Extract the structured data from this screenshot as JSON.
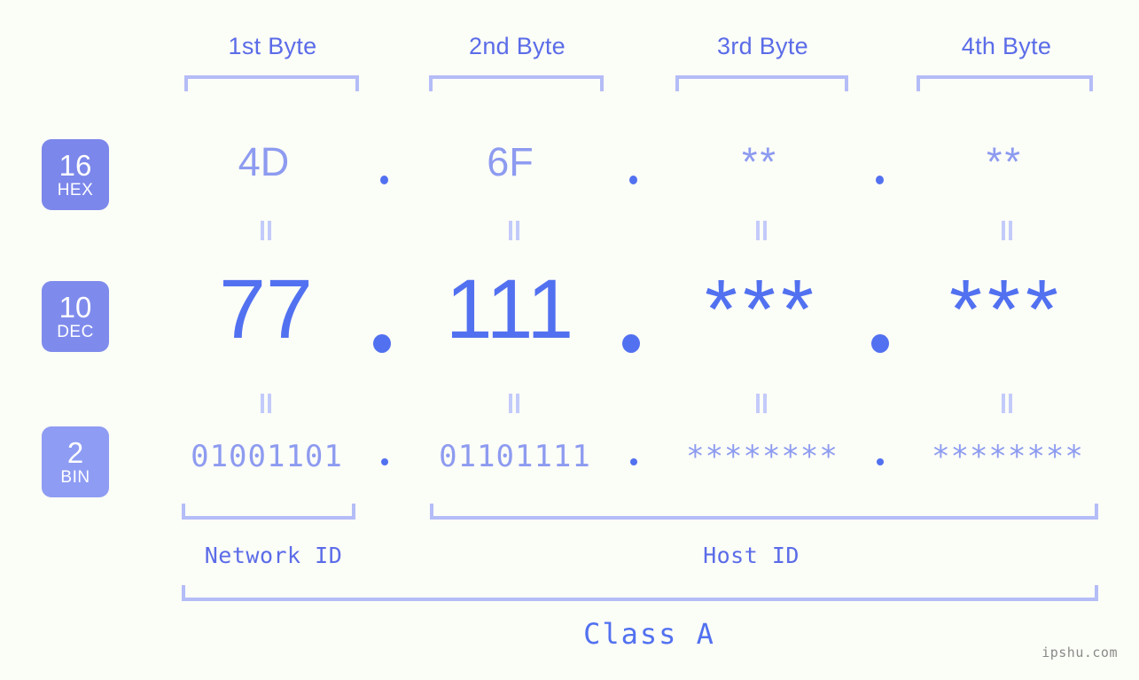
{
  "meta": {
    "background": "#fbfdf7",
    "accent_strong": "#5271f0",
    "accent_mid": "#5b6ce8",
    "accent_light": "#8d9bf0",
    "accent_pale": "#b4bdf7",
    "badge_hex_bg": "#7b87ea",
    "badge_dec_bg": "#7f8bec",
    "badge_bin_bg": "#8e9cf3"
  },
  "headers": [
    {
      "label": "1st Byte"
    },
    {
      "label": "2nd Byte"
    },
    {
      "label": "3rd Byte"
    },
    {
      "label": "4th Byte"
    }
  ],
  "badges": [
    {
      "num": "16",
      "sub": "HEX",
      "name": "hex"
    },
    {
      "num": "10",
      "sub": "DEC",
      "name": "dec"
    },
    {
      "num": "2",
      "sub": "BIN",
      "name": "bin"
    }
  ],
  "rows": {
    "hex": {
      "radix": "16",
      "radix_label": "HEX",
      "values": [
        "4D",
        "6F",
        "**",
        "**"
      ],
      "masked": [
        false,
        false,
        true,
        true
      ],
      "separator": "."
    },
    "dec": {
      "radix": "10",
      "radix_label": "DEC",
      "values": [
        "77",
        "111",
        "***",
        "***"
      ],
      "masked": [
        false,
        false,
        true,
        true
      ],
      "separator": "."
    },
    "bin": {
      "radix": "2",
      "radix_label": "BIN",
      "values": [
        "01001101",
        "01101111",
        "********",
        "********"
      ],
      "masked": [
        false,
        false,
        true,
        true
      ],
      "separator": "."
    }
  },
  "equals_marks": {
    "symbol": "||",
    "count_per_row": 4,
    "rows": 2
  },
  "sections": [
    {
      "label": "Network ID",
      "name": "network-id"
    },
    {
      "label": "Host ID",
      "name": "host-id"
    }
  ],
  "class": {
    "label": "Class A"
  },
  "watermark": {
    "label": "ipshu.com"
  }
}
